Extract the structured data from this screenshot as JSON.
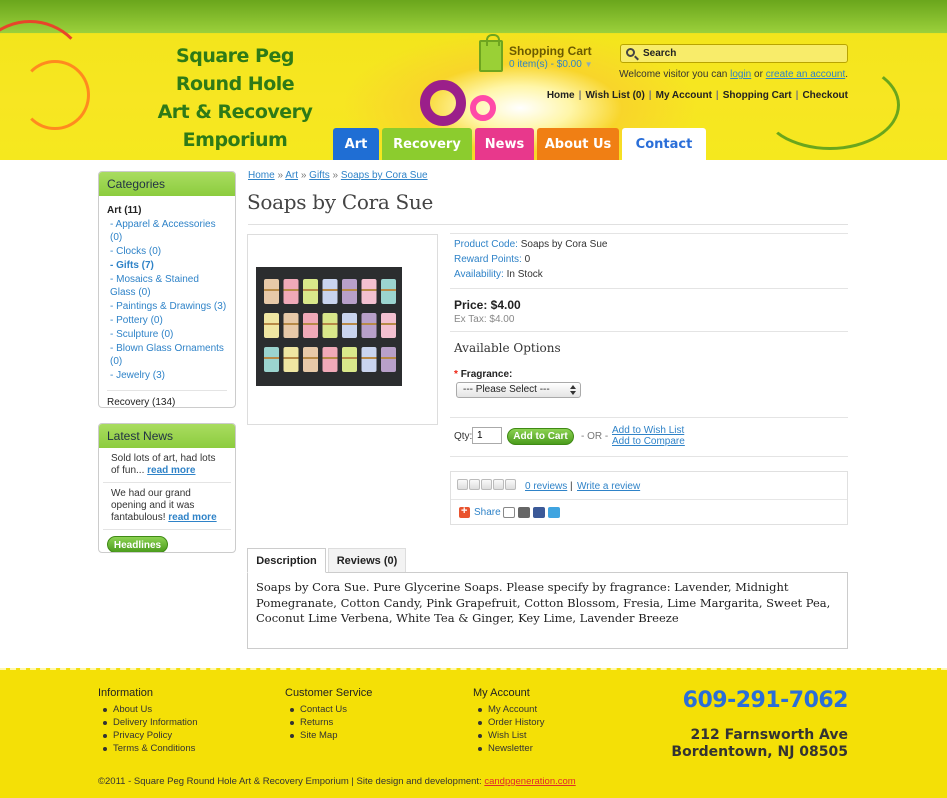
{
  "header": {
    "logo_lines": [
      "Square Peg",
      "Round Hole",
      "Art & Recovery",
      "Emporium"
    ],
    "cart_title": "Shopping Cart",
    "cart_summary": "0 item(s) - $0.00",
    "search_value": "Search",
    "welcome_prefix": "Welcome visitor you can",
    "login_label": "login",
    "or_text": "or",
    "create_account_label": "create an account",
    "top_links": [
      "Home",
      "Wish List (0)",
      "My Account",
      "Shopping Cart",
      "Checkout"
    ]
  },
  "nav_tabs": [
    {
      "label": "Art",
      "color": "#1f6ed4"
    },
    {
      "label": "Recovery",
      "color": "#8ccc2e"
    },
    {
      "label": "News",
      "color": "#e8388c"
    },
    {
      "label": "About Us",
      "color": "#f07f14"
    },
    {
      "label": "Contact",
      "color": "#ffffff"
    }
  ],
  "categories": {
    "title": "Categories",
    "art_label": "Art (11)",
    "art_children": [
      "- Apparel & Accessories (0)",
      "- Clocks (0)",
      "- Gifts (7)",
      "- Mosaics & Stained Glass (0)",
      "- Paintings & Drawings (3)",
      "- Pottery (0)",
      "- Sculpture (0)",
      "- Blown Glass Ornaments (0)",
      "- Jewelry (3)"
    ],
    "recovery_label": "Recovery (134)"
  },
  "latest_news": {
    "title": "Latest News",
    "items": [
      {
        "text": "Sold lots of art, had lots of fun...",
        "more": "read more"
      },
      {
        "text": "We had our grand opening and it was fantabulous!",
        "more": "read more"
      }
    ],
    "button": "Headlines"
  },
  "breadcrumb": [
    "Home",
    "Art",
    "Gifts",
    "Soaps by Cora Sue"
  ],
  "breadcrumb_sep": "»",
  "product": {
    "title": "Soaps by Cora Sue",
    "code_label": "Product Code:",
    "code_value": "Soaps by Cora Sue",
    "reward_label": "Reward Points:",
    "reward_value": "0",
    "avail_label": "Availability:",
    "avail_value": "In Stock",
    "price": "Price: $4.00",
    "ex_tax": "Ex Tax: $4.00",
    "options_title": "Available Options",
    "fragrance_label": "Fragrance:",
    "required_mark": "*",
    "select_value": "--- Please Select ---",
    "qty_label": "Qty:",
    "qty_value": "1",
    "add_to_cart": "Add to Cart",
    "or": "- OR -",
    "wish_link": "Add to Wish List",
    "compare_link": "Add to Compare",
    "rating_value": 0,
    "rating_max": 5,
    "reviews_link": "0 reviews",
    "review_sep": "|",
    "write_review": "Write a review",
    "share_label": "Share"
  },
  "desc_tabs": [
    "Description",
    "Reviews (0)"
  ],
  "description": "Soaps by Cora Sue.  Pure Glycerine Soaps.  Please specify by fragrance:  Lavender, Midnight Pomegranate, Cotton Candy, Pink Grapefruit, Cotton Blossom, Fresia, Lime Margarita, Sweet Pea, Coconut Lime Verbena, White Tea & Ginger, Key Lime, Lavender Breeze",
  "footer": {
    "columns": [
      {
        "title": "Information",
        "links": [
          "About Us",
          "Delivery Information",
          "Privacy Policy",
          "Terms & Conditions"
        ]
      },
      {
        "title": "Customer Service",
        "links": [
          "Contact Us",
          "Returns",
          "Site Map"
        ]
      },
      {
        "title": "My Account",
        "links": [
          "My Account",
          "Order History",
          "Wish List",
          "Newsletter"
        ]
      }
    ],
    "phone": "609-291-7062",
    "address_line1": "212 Farnsworth Ave",
    "address_line2": "Bordentown, NJ 08505",
    "copyright": "©2011 - Square Peg Round Hole Art & Recovery Emporium   |   Site design and development:",
    "dev_link": "candpgeneration.com"
  }
}
